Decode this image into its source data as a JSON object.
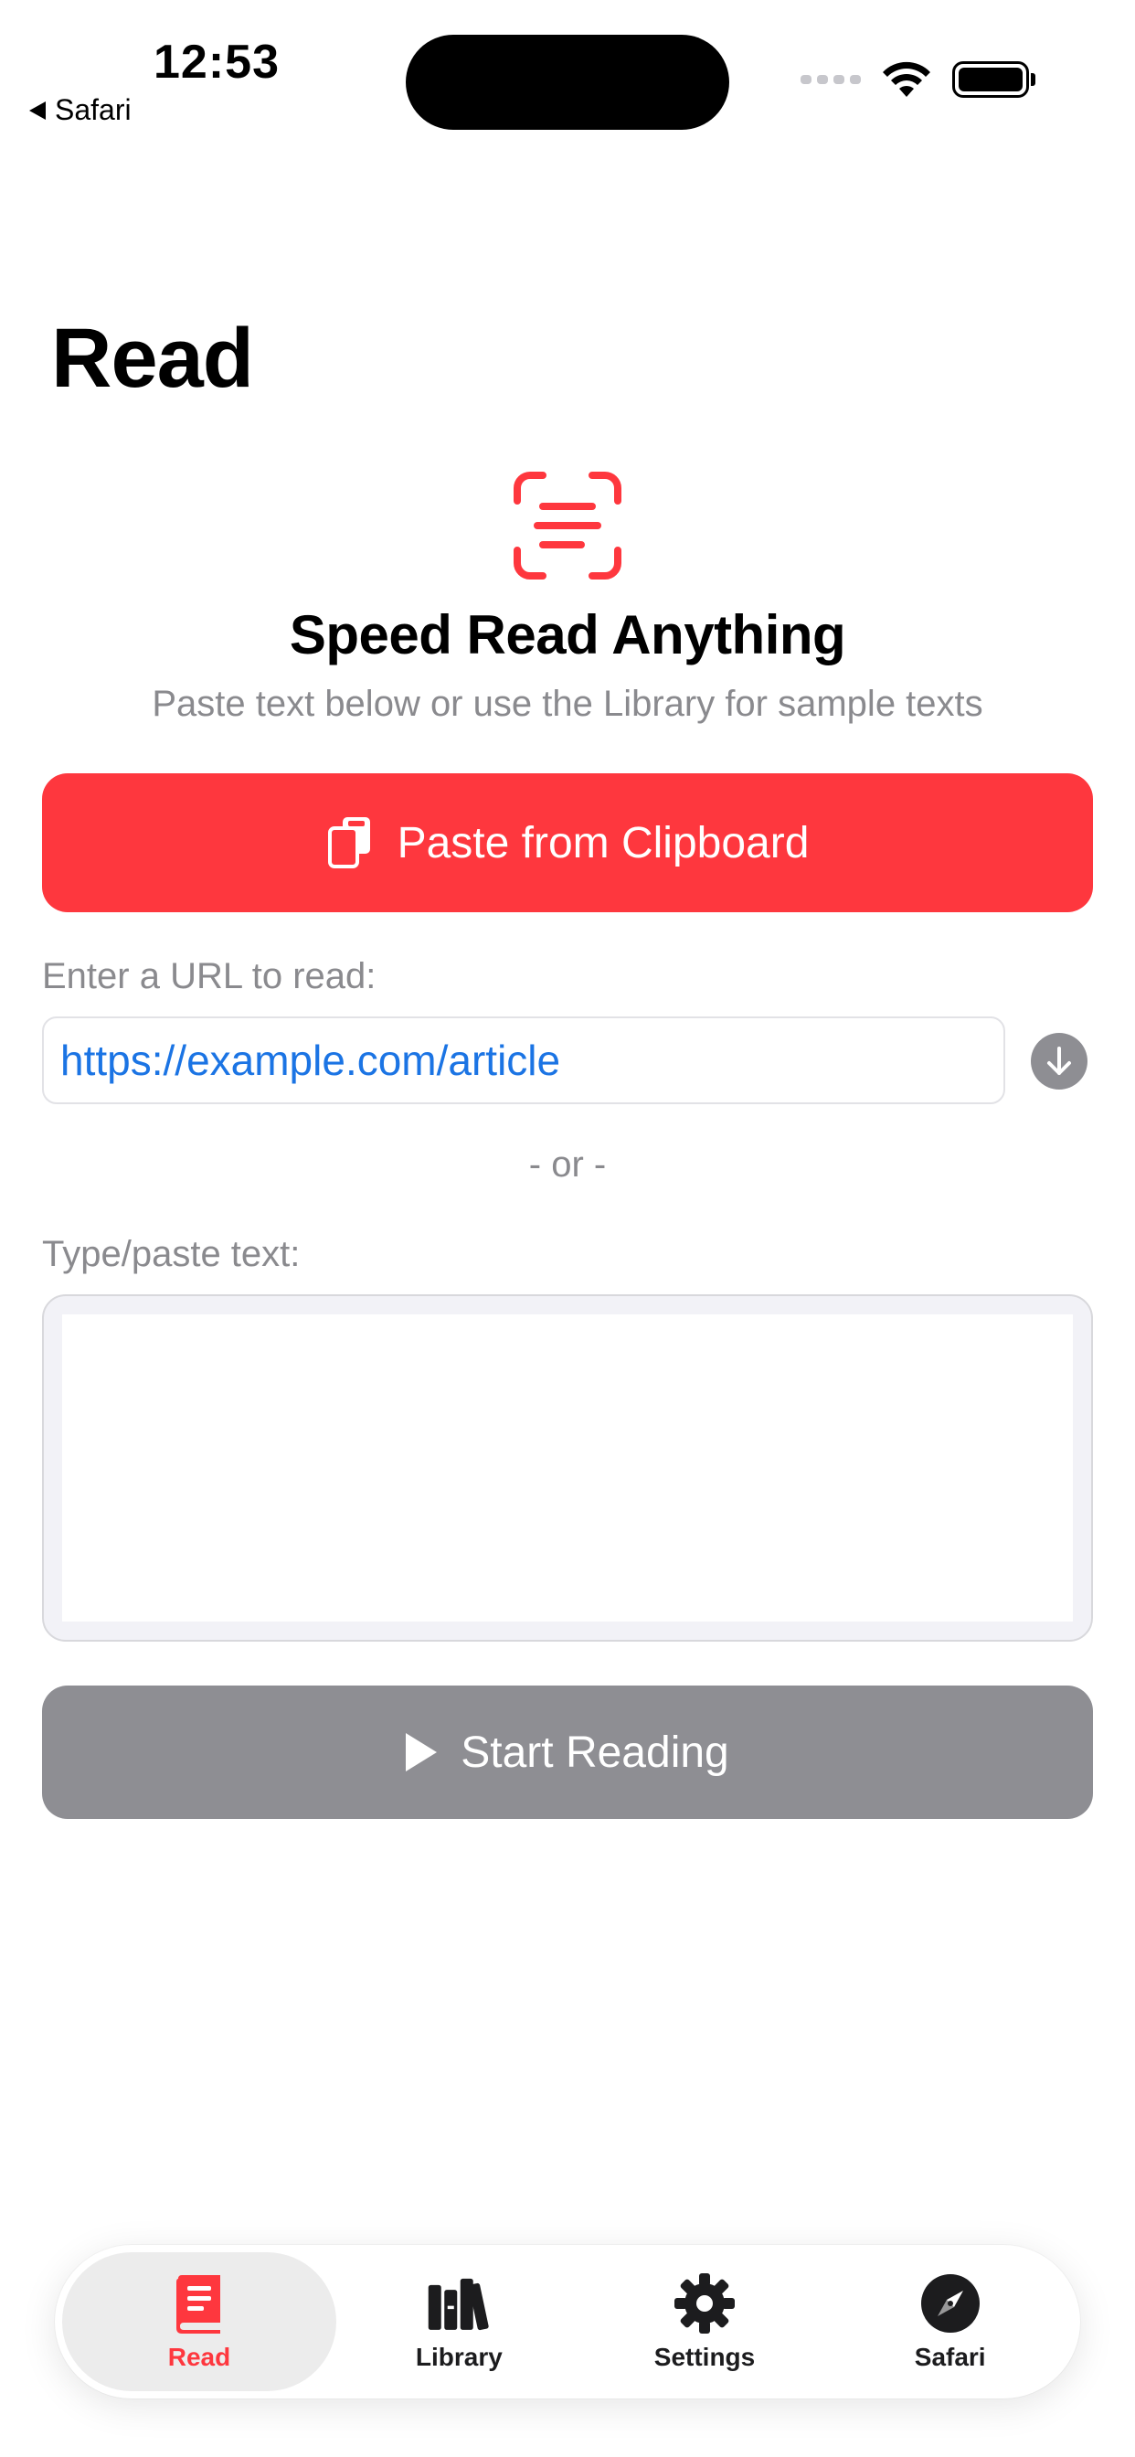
{
  "status_bar": {
    "time": "12:53",
    "back_app": "Safari"
  },
  "page": {
    "title": "Read"
  },
  "hero": {
    "icon": "text-viewfinder-icon",
    "heading": "Speed Read Anything",
    "subtitle": "Paste text below or use the Library for sample texts"
  },
  "paste_button": {
    "label": "Paste from Clipboard",
    "icon": "clipboard-icon"
  },
  "url": {
    "label": "Enter a URL to read:",
    "value": "https://example.com/article",
    "go_icon": "arrow-down-circle-icon"
  },
  "divider": "- or -",
  "text_input": {
    "label": "Type/paste text:",
    "value": ""
  },
  "start_button": {
    "label": "Start Reading",
    "icon": "play-icon"
  },
  "tabs": [
    {
      "label": "Read",
      "icon": "book-icon",
      "active": true
    },
    {
      "label": "Library",
      "icon": "books-icon",
      "active": false
    },
    {
      "label": "Settings",
      "icon": "gear-icon",
      "active": false
    },
    {
      "label": "Safari",
      "icon": "compass-icon",
      "active": false
    }
  ],
  "colors": {
    "accent": "#fe373e",
    "disabled_button": "#8e8e93",
    "link": "#1b74e4",
    "secondary_text": "#8a8a8e"
  }
}
